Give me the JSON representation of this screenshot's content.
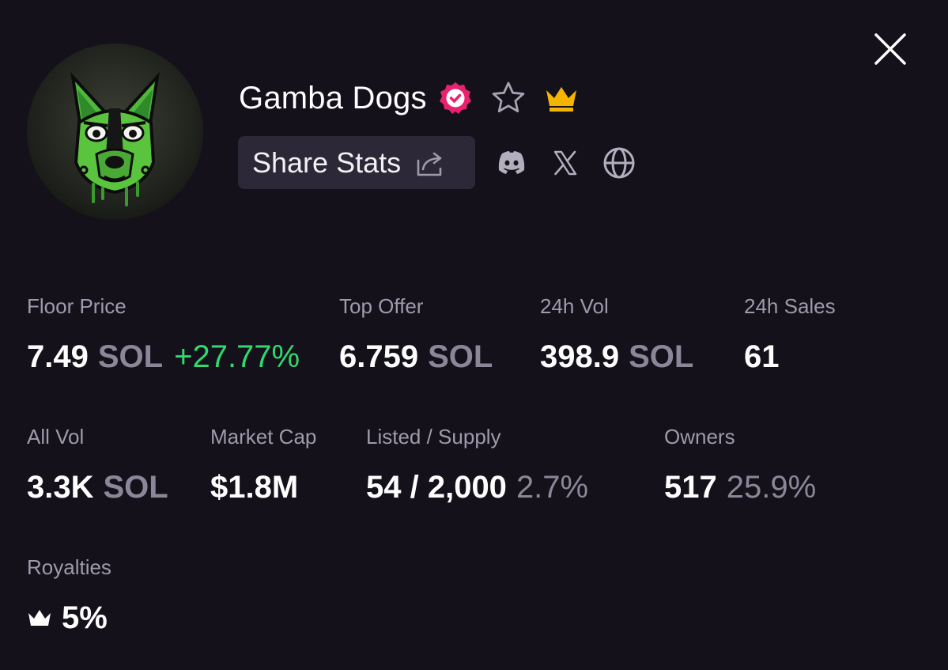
{
  "header": {
    "title": "Gamba Dogs",
    "share_label": "Share Stats"
  },
  "icons": {
    "close": "close-icon",
    "verified": "verified-badge-icon",
    "favorite": "star-icon",
    "tier": "crown-icon",
    "share": "share-icon",
    "discord": "discord-icon",
    "x": "x-icon",
    "website": "globe-icon",
    "royalty": "crown-icon"
  },
  "colors": {
    "background": "#14111b",
    "verified": "#e8226f",
    "crown": "#f5b400",
    "positive": "#2ddb6f",
    "muted": "#8b8799",
    "button_bg": "#2c2837"
  },
  "stats": {
    "floor_price": {
      "label": "Floor Price",
      "value": "7.49",
      "unit": "SOL",
      "change": "+27.77%"
    },
    "top_offer": {
      "label": "Top Offer",
      "value": "6.759",
      "unit": "SOL"
    },
    "vol_24h": {
      "label": "24h Vol",
      "value": "398.9",
      "unit": "SOL"
    },
    "sales_24h": {
      "label": "24h Sales",
      "value": "61"
    },
    "all_vol": {
      "label": "All Vol",
      "value": "3.3K",
      "unit": "SOL"
    },
    "market_cap": {
      "label": "Market Cap",
      "value": "$1.8M"
    },
    "listed_supply": {
      "label": "Listed / Supply",
      "value": "54 / 2,000",
      "pct": "2.7%"
    },
    "owners": {
      "label": "Owners",
      "value": "517",
      "pct": "25.9%"
    },
    "royalties": {
      "label": "Royalties",
      "value": "5%"
    }
  }
}
